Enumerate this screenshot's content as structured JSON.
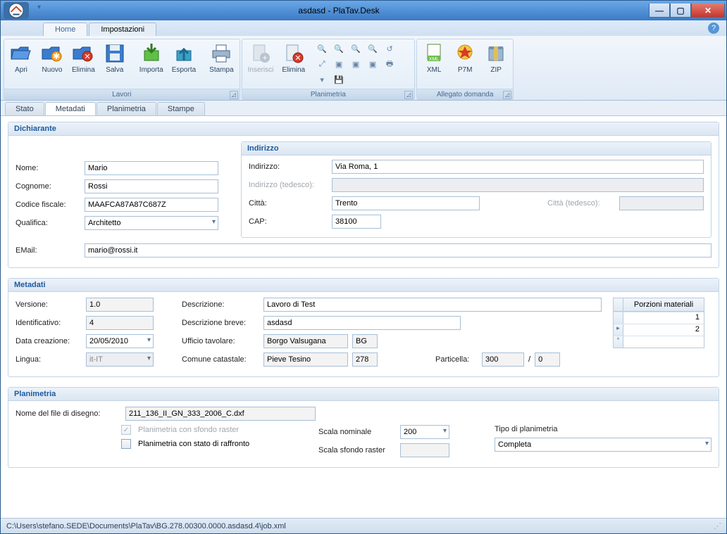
{
  "window": {
    "title": "asdasd - PlaTav.Desk"
  },
  "ribbonTabs": {
    "home": "Home",
    "impostazioni": "Impostazioni"
  },
  "ribbon": {
    "lavori": {
      "label": "Lavori",
      "apri": "Apri",
      "nuovo": "Nuovo",
      "elimina": "Elimina",
      "salva": "Salva",
      "importa": "Importa",
      "esporta": "Esporta",
      "stampa": "Stampa"
    },
    "planimetria": {
      "label": "Planimetria",
      "inserisci": "Inserisci",
      "elimina": "Elimina"
    },
    "allegato": {
      "label": "Allegato domanda",
      "xml": "XML",
      "p7m": "P7M",
      "zip": "ZIP"
    }
  },
  "contentTabs": {
    "stato": "Stato",
    "metadati": "Metadati",
    "planimetria": "Planimetria",
    "stampe": "Stampe"
  },
  "dichiarante": {
    "title": "Dichiarante",
    "nome_label": "Nome:",
    "nome": "Mario",
    "cognome_label": "Cognome:",
    "cognome": "Rossi",
    "cf_label": "Codice fiscale:",
    "cf": "MAAFCA87A87C687Z",
    "qualifica_label": "Qualifica:",
    "qualifica": "Architetto",
    "email_label": "EMail:",
    "email": "mario@rossi.it",
    "indirizzo": {
      "title": "Indirizzo",
      "indirizzo_label": "Indirizzo:",
      "indirizzo": "Via Roma, 1",
      "indirizzo_de_label": "Indirizzo (tedesco):",
      "indirizzo_de": "",
      "citta_label": "Città:",
      "citta": "Trento",
      "citta_de_label": "Città (tedesco):",
      "citta_de": "",
      "cap_label": "CAP:",
      "cap": "38100"
    }
  },
  "metadati": {
    "title": "Metadati",
    "versione_label": "Versione:",
    "versione": "1.0",
    "identificativo_label": "Identificativo:",
    "identificativo": "4",
    "data_label": "Data creazione:",
    "data": "20/05/2010",
    "lingua_label": "Lingua:",
    "lingua": "it-IT",
    "descr_label": "Descrizione:",
    "descr": "Lavoro di Test",
    "descr_breve_label": "Descrizione breve:",
    "descr_breve": "asdasd",
    "ut_label": "Ufficio tavolare:",
    "ut_name": "Borgo Valsugana",
    "ut_code": "BG",
    "cc_label": "Comune catastale:",
    "cc_name": "Pieve Tesino",
    "cc_code": "278",
    "part_label": "Particella:",
    "part_n": "300",
    "part_sep": "/",
    "part_d": "0",
    "porzioni_header": "Porzioni materiali",
    "porzioni": [
      "1",
      "2"
    ]
  },
  "planimetria": {
    "title": "Planimetria",
    "file_label": "Nome del file di disegno:",
    "file": "211_136_II_GN_333_2006_C.dxf",
    "raster_chk": "Planimetria con sfondo raster",
    "raffronto_chk": "Planimetria con stato di raffronto",
    "scala_nom_label": "Scala nominale",
    "scala_nom": "200",
    "scala_raster_label": "Scala sfondo raster",
    "scala_raster": "",
    "tipo_label": "Tipo di planimetria",
    "tipo": "Completa"
  },
  "statusbar": {
    "path": "C:\\Users\\stefano.SEDE\\Documents\\PlaTav\\BG.278.00300.0000.asdasd.4\\job.xml"
  }
}
